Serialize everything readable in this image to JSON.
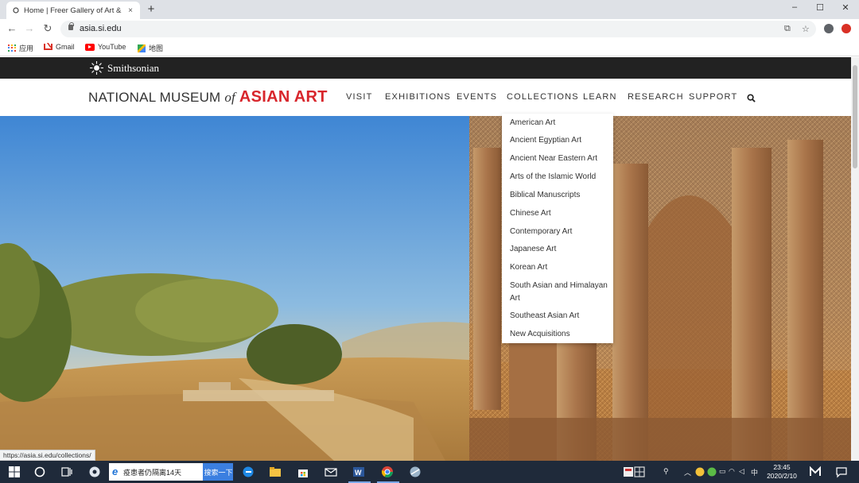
{
  "browser": {
    "tab_title": "Home | Freer Gallery of Art &",
    "tab_close": "×",
    "new_tab": "+",
    "window_controls": [
      "–",
      "☐",
      "✕"
    ],
    "url": "asia.si.edu",
    "bookmarks": [
      {
        "label": "应用",
        "icon": "apps-grid-icon"
      },
      {
        "label": "Gmail",
        "icon": "gmail-icon"
      },
      {
        "label": "YouTube",
        "icon": "youtube-icon"
      },
      {
        "label": "地图",
        "icon": "maps-icon"
      }
    ],
    "status_url": "https://asia.si.edu/collections/"
  },
  "site": {
    "smithsonian": "Smithsonian",
    "logo": {
      "prefix": "NATIONAL MUSEUM ",
      "of": "of",
      "highlight": "ASIAN ART"
    },
    "nav": [
      "VISIT",
      "EXHIBITIONS",
      "EVENTS",
      "COLLECTIONS",
      "LEARN",
      "RESEARCH",
      "SUPPORT"
    ],
    "collections_menu": [
      "American Art",
      "Ancient Egyptian Art",
      "Ancient Near Eastern Art",
      "Arts of the Islamic World",
      "Biblical Manuscripts",
      "Chinese Art",
      "Contemporary Art",
      "Japanese Art",
      "Korean Art",
      "South Asian and Himalayan Art",
      "Southeast Asian Art",
      "New Acquisitions"
    ]
  },
  "taskbar": {
    "search_text": "疫患者仍隔离14天",
    "search_button": "搜索一下",
    "ime": "中",
    "time": "23:45",
    "date": "2020/2/10"
  },
  "colors": {
    "brand_red": "#d8262c",
    "smithsonian_bar": "#222222",
    "taskbar": "#1f2a3a"
  }
}
